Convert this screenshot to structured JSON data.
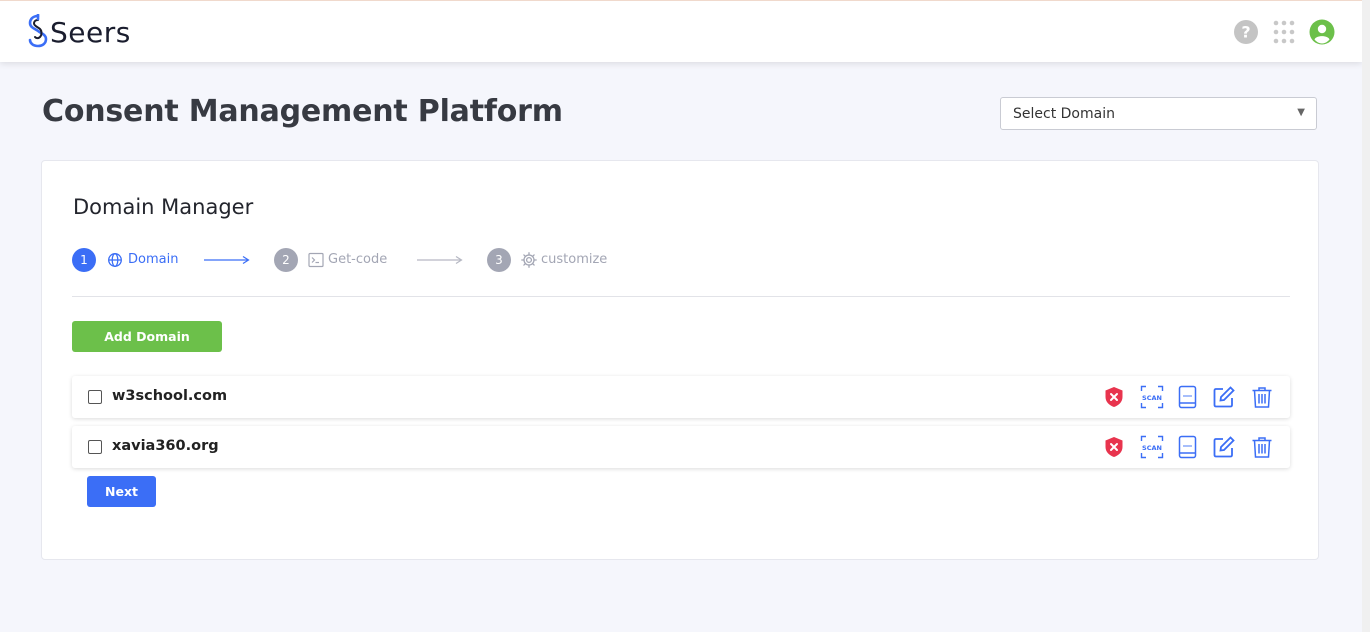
{
  "header": {
    "brand": "Seers",
    "icons": [
      "help-icon",
      "apps-grid-icon",
      "user-account-icon"
    ]
  },
  "page": {
    "title": "Consent Management Platform",
    "domain_select": {
      "selected": "Select Domain"
    }
  },
  "card": {
    "title": "Domain Manager",
    "steps": [
      {
        "number": "1",
        "label": "Domain",
        "icon": "globe-icon",
        "active": true
      },
      {
        "number": "2",
        "label": "Get-code",
        "icon": "terminal-icon",
        "active": false
      },
      {
        "number": "3",
        "label": "customize",
        "icon": "gear-icon",
        "active": false
      }
    ],
    "add_domain_label": "Add Domain",
    "domains": [
      {
        "name": "w3school.com",
        "checked": false
      },
      {
        "name": "xavia360.org",
        "checked": false
      }
    ],
    "row_action_icons": [
      "shield-x-icon",
      "scan-icon",
      "report-icon",
      "edit-icon",
      "trash-icon"
    ],
    "next_label": "Next"
  },
  "colors": {
    "primary_blue": "#3b6ef6",
    "green": "#6cc04a",
    "danger_red": "#e8344e",
    "inactive_step": "#a3a6b4",
    "background": "#f5f6fc"
  }
}
